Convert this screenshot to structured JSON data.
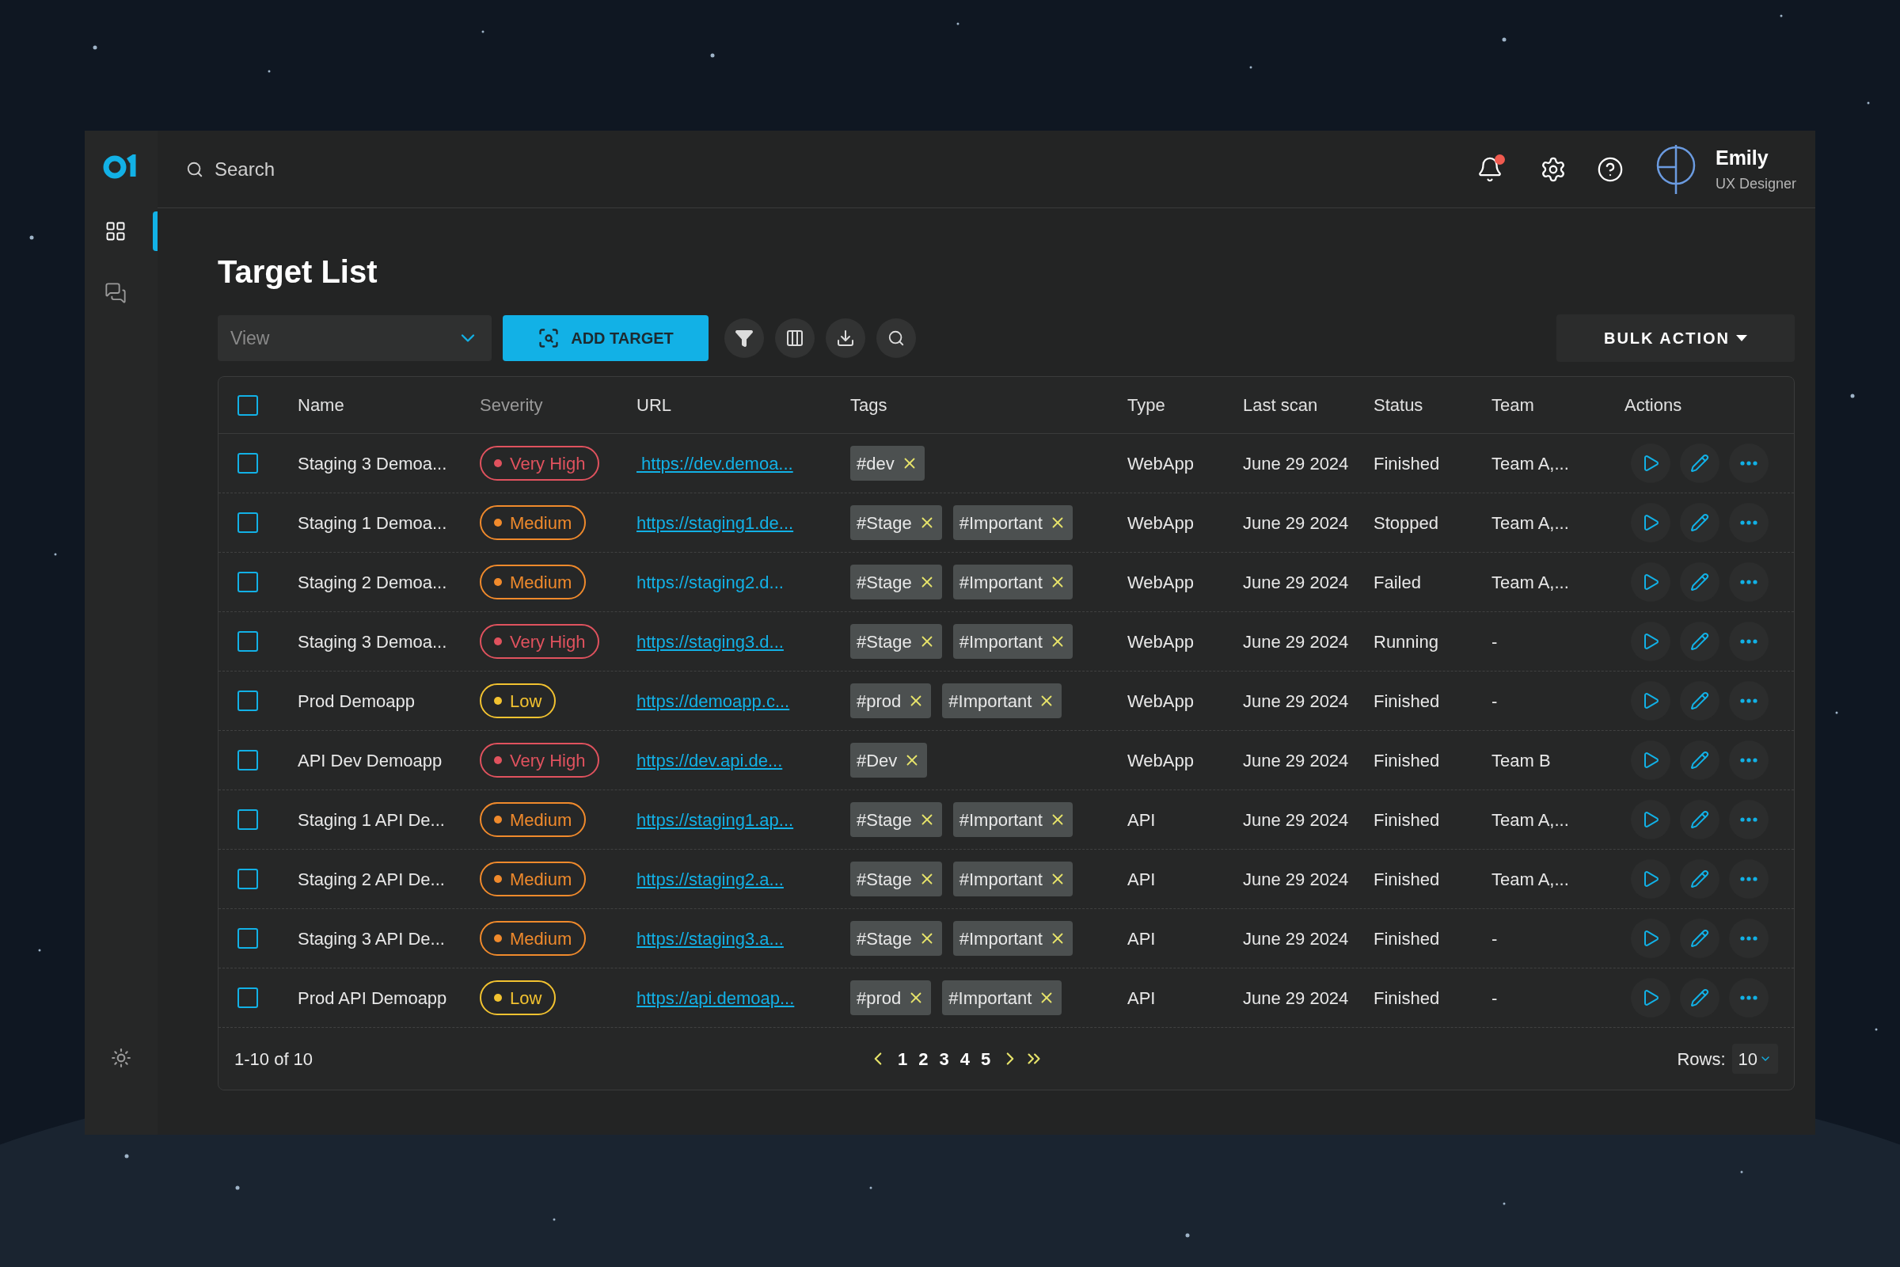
{
  "header": {
    "search_placeholder": "Search",
    "notification_unread": true,
    "user": {
      "name": "Emily",
      "role": "UX Designer"
    }
  },
  "sidebar": {
    "items": [
      {
        "kind": "grid",
        "selected": true
      },
      {
        "kind": "chat",
        "selected": false
      }
    ]
  },
  "page": {
    "title": "Target List",
    "view_placeholder": "View",
    "add_button": "ADD TARGET",
    "bulk_action": "BULK ACTION"
  },
  "table": {
    "all_checked": false,
    "columns": [
      "Name",
      "Severity",
      "URL",
      "Tags",
      "Type",
      "Last scan",
      "Status",
      "Team",
      "Actions"
    ],
    "rows": [
      {
        "checked": false,
        "name": "Staging 3 Demoa...",
        "severity": {
          "label": "Very High",
          "color": "#e0525e"
        },
        "url": " https://dev.demoa...",
        "url_underlined": true,
        "tags": [
          "#dev"
        ],
        "type": "WebApp",
        "last_scan": "June 29 2024",
        "status": "Finished",
        "team": "Team A,..."
      },
      {
        "checked": false,
        "name": "Staging 1 Demoa...",
        "severity": {
          "label": "Medium",
          "color": "#f08a2c"
        },
        "url": "https://staging1.de...",
        "url_underlined": true,
        "tags": [
          "#Stage",
          "#Important"
        ],
        "type": "WebApp",
        "last_scan": "June 29 2024",
        "status": "Stopped",
        "team": "Team A,..."
      },
      {
        "checked": false,
        "name": "Staging 2 Demoa...",
        "severity": {
          "label": "Medium",
          "color": "#f08a2c"
        },
        "url": "https://staging2.d...",
        "url_underlined": false,
        "tags": [
          "#Stage",
          "#Important"
        ],
        "type": "WebApp",
        "last_scan": "June 29 2024",
        "status": "Failed",
        "team": "Team A,..."
      },
      {
        "checked": false,
        "name": "Staging 3 Demoa...",
        "severity": {
          "label": "Very High",
          "color": "#e0525e"
        },
        "url": "https://staging3.d...",
        "url_underlined": true,
        "tags": [
          "#Stage",
          "#Important"
        ],
        "type": "WebApp",
        "last_scan": "June 29 2024",
        "status": "Running",
        "team": "-"
      },
      {
        "checked": false,
        "name": "Prod Demoapp",
        "severity": {
          "label": "Low",
          "color": "#f2c230"
        },
        "url": "https://demoapp.c...",
        "url_underlined": true,
        "tags": [
          "#prod",
          "#Important"
        ],
        "type": "WebApp",
        "last_scan": "June 29 2024",
        "status": "Finished",
        "team": "-"
      },
      {
        "checked": false,
        "name": "API Dev Demoapp",
        "severity": {
          "label": "Very High",
          "color": "#e0525e"
        },
        "url": "https://dev.api.de...",
        "url_underlined": true,
        "tags": [
          "#Dev"
        ],
        "type": "WebApp",
        "last_scan": "June 29 2024",
        "status": "Finished",
        "team": "Team B"
      },
      {
        "checked": false,
        "name": "Staging 1 API De...",
        "severity": {
          "label": "Medium",
          "color": "#f08a2c"
        },
        "url": "https://staging1.ap...",
        "url_underlined": true,
        "tags": [
          "#Stage",
          "#Important"
        ],
        "type": "API",
        "last_scan": "June 29 2024",
        "status": "Finished",
        "team": "Team A,..."
      },
      {
        "checked": false,
        "name": "Staging 2 API De...",
        "severity": {
          "label": "Medium",
          "color": "#f08a2c"
        },
        "url": "https://staging2.a...",
        "url_underlined": true,
        "tags": [
          "#Stage",
          "#Important"
        ],
        "type": "API",
        "last_scan": "June 29 2024",
        "status": "Finished",
        "team": "Team A,..."
      },
      {
        "checked": false,
        "name": "Staging 3 API De...",
        "severity": {
          "label": "Medium",
          "color": "#f08a2c"
        },
        "url": "https://staging3.a...",
        "url_underlined": true,
        "tags": [
          "#Stage",
          "#Important"
        ],
        "type": "API",
        "last_scan": "June 29 2024",
        "status": "Finished",
        "team": "-"
      },
      {
        "checked": false,
        "name": "Prod API Demoapp",
        "severity": {
          "label": "Low",
          "color": "#f2c230"
        },
        "url": "https://api.demoap...",
        "url_underlined": true,
        "tags": [
          "#prod",
          "#Important"
        ],
        "type": "API",
        "last_scan": "June 29 2024",
        "status": "Finished",
        "team": "-"
      }
    ]
  },
  "footer": {
    "range": "1-10 of 10",
    "pages": [
      "1",
      "2",
      "3",
      "4",
      "5"
    ],
    "rows_label": "Rows:",
    "rows_value": "10"
  }
}
